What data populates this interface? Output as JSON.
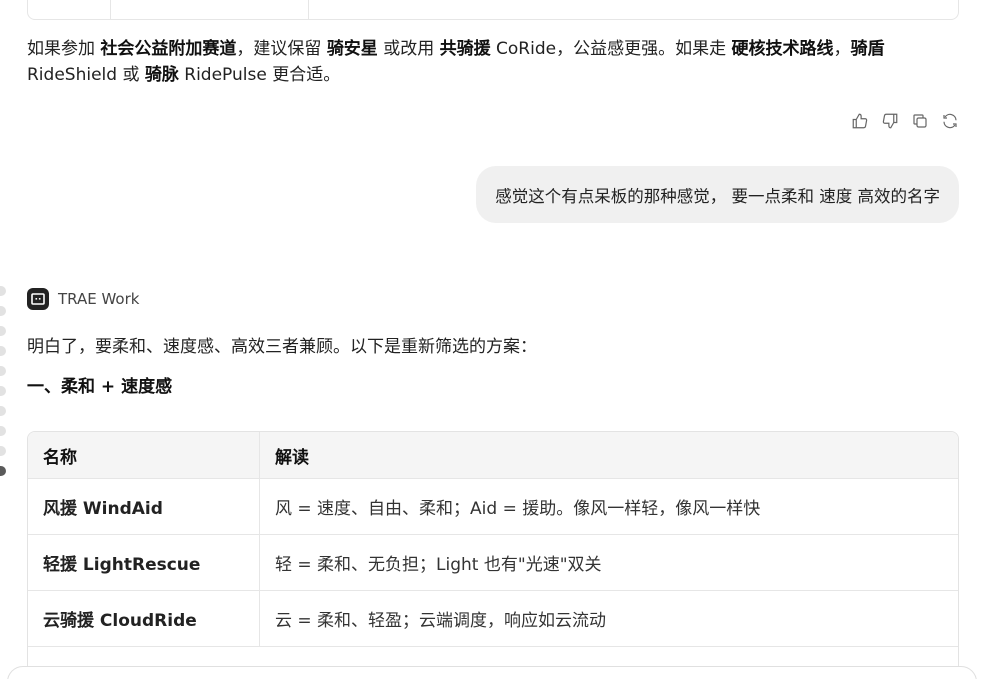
{
  "previous_reply": {
    "summary_parts": [
      {
        "text": "如果参加 ",
        "bold": false
      },
      {
        "text": "社会公益附加赛道",
        "bold": true
      },
      {
        "text": "，建议保留 ",
        "bold": false
      },
      {
        "text": "骑安星",
        "bold": true
      },
      {
        "text": " 或改用 ",
        "bold": false
      },
      {
        "text": "共骑援",
        "bold": true
      },
      {
        "text": " CoRide，公益感更强。如果走 ",
        "bold": false
      },
      {
        "text": "硬核技术路线",
        "bold": true
      },
      {
        "text": "，",
        "bold": false
      },
      {
        "text": "骑盾",
        "bold": true
      },
      {
        "text": " RideShield 或 ",
        "bold": false
      },
      {
        "text": "骑脉",
        "bold": true
      },
      {
        "text": " RidePulse 更合适。",
        "bold": false
      }
    ],
    "actions": {
      "like": "thumbs-up-icon",
      "dislike": "thumbs-down-icon",
      "copy": "copy-icon",
      "regenerate": "refresh-icon"
    }
  },
  "user_message": "感觉这个有点呆板的那种感觉， 要一点柔和 速度 高效的名字",
  "agent": {
    "name": "TRAE Work",
    "intro": "明白了，要柔和、速度感、高效三者兼顾。以下是重新筛选的方案：",
    "section_title": "一、柔和 + 速度感",
    "table": {
      "headers": [
        "名称",
        "解读"
      ],
      "rows": [
        [
          "风援 WindAid",
          "风 = 速度、自由、柔和；Aid = 援助。像风一样轻，像风一样快"
        ],
        [
          "轻援 LightRescue",
          "轻 = 柔和、无负担；Light 也有\"光速\"双关"
        ],
        [
          "云骑援 CloudRide",
          "云 = 柔和、轻盈；云端调度，响应如云流动"
        ]
      ]
    }
  },
  "colors": {
    "bubble": "#f0f0f0",
    "table_header": "#f5f5f5",
    "border": "#e6e6e6"
  }
}
